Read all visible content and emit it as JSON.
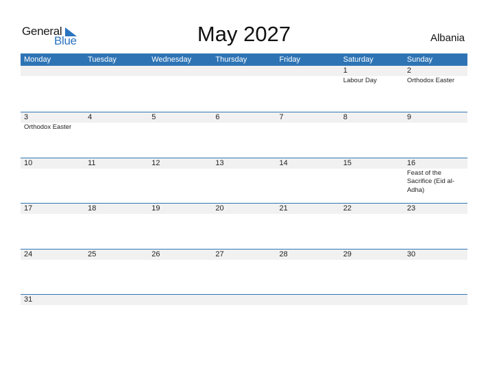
{
  "logo": {
    "general": "General",
    "blue": "Blue"
  },
  "header": {
    "title": "May 2027",
    "country": "Albania"
  },
  "weekdays": [
    "Monday",
    "Tuesday",
    "Wednesday",
    "Thursday",
    "Friday",
    "Saturday",
    "Sunday"
  ],
  "weeks": [
    [
      {
        "day": "",
        "events": ""
      },
      {
        "day": "",
        "events": ""
      },
      {
        "day": "",
        "events": ""
      },
      {
        "day": "",
        "events": ""
      },
      {
        "day": "",
        "events": ""
      },
      {
        "day": "1",
        "events": "Labour Day"
      },
      {
        "day": "2",
        "events": "Orthodox Easter"
      }
    ],
    [
      {
        "day": "3",
        "events": "Orthodox Easter"
      },
      {
        "day": "4",
        "events": ""
      },
      {
        "day": "5",
        "events": ""
      },
      {
        "day": "6",
        "events": ""
      },
      {
        "day": "7",
        "events": ""
      },
      {
        "day": "8",
        "events": ""
      },
      {
        "day": "9",
        "events": ""
      }
    ],
    [
      {
        "day": "10",
        "events": ""
      },
      {
        "day": "11",
        "events": ""
      },
      {
        "day": "12",
        "events": ""
      },
      {
        "day": "13",
        "events": ""
      },
      {
        "day": "14",
        "events": ""
      },
      {
        "day": "15",
        "events": ""
      },
      {
        "day": "16",
        "events": "Feast of the Sacrifice (Eid al-Adha)"
      }
    ],
    [
      {
        "day": "17",
        "events": ""
      },
      {
        "day": "18",
        "events": ""
      },
      {
        "day": "19",
        "events": ""
      },
      {
        "day": "20",
        "events": ""
      },
      {
        "day": "21",
        "events": ""
      },
      {
        "day": "22",
        "events": ""
      },
      {
        "day": "23",
        "events": ""
      }
    ],
    [
      {
        "day": "24",
        "events": ""
      },
      {
        "day": "25",
        "events": ""
      },
      {
        "day": "26",
        "events": ""
      },
      {
        "day": "27",
        "events": ""
      },
      {
        "day": "28",
        "events": ""
      },
      {
        "day": "29",
        "events": ""
      },
      {
        "day": "30",
        "events": ""
      }
    ],
    [
      {
        "day": "31",
        "events": ""
      },
      {
        "day": "",
        "events": ""
      },
      {
        "day": "",
        "events": ""
      },
      {
        "day": "",
        "events": ""
      },
      {
        "day": "",
        "events": ""
      },
      {
        "day": "",
        "events": ""
      },
      {
        "day": "",
        "events": ""
      }
    ]
  ],
  "colors": {
    "accent": "#2e74b5",
    "strip": "#f1f1f1"
  }
}
